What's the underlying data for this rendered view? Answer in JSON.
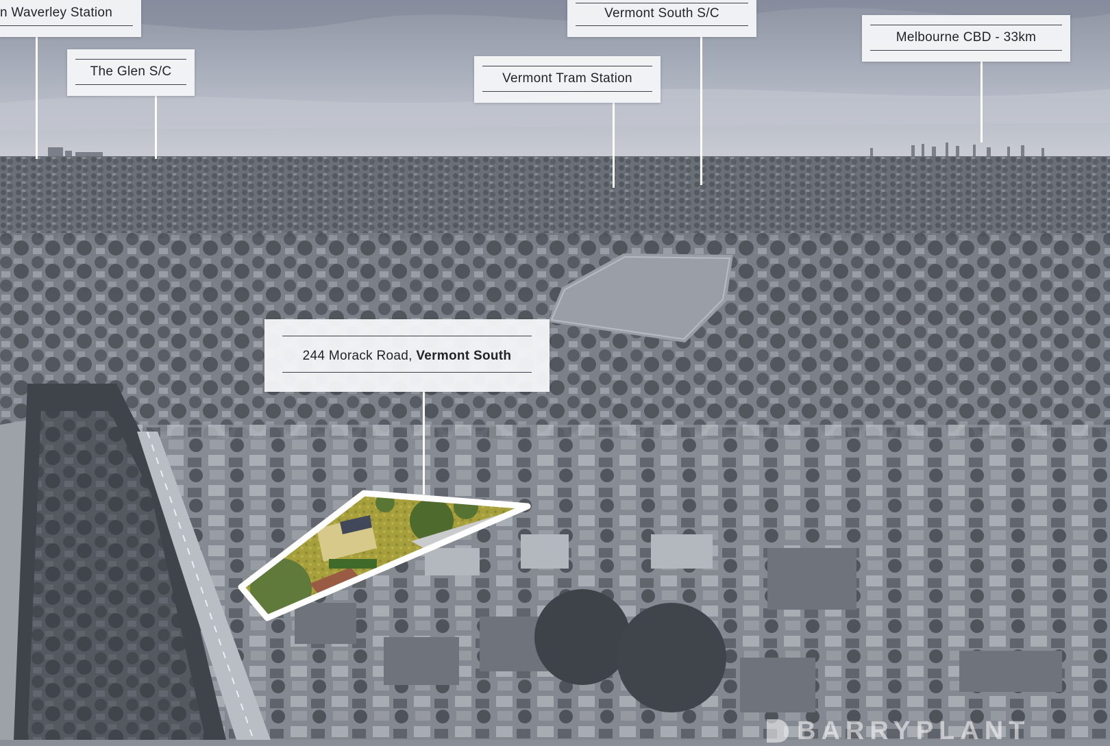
{
  "labels": {
    "waverley": "n Waverley Station",
    "glen": "The Glen S/C",
    "vermont_south_sc": "Vermont South S/C",
    "tram": "Vermont Tram Station",
    "cbd": "Melbourne CBD - 33km",
    "property_street": "244 Morack Road, ",
    "property_suburb": "Vermont South"
  },
  "brand": {
    "watermark": "BARRYPLANT"
  },
  "colors": {
    "sky": "#a7adbb",
    "ground": "#7d8189",
    "callout_bg": "#f4f5f7",
    "pin": "#ffffff",
    "highlight_outline": "#ffffff",
    "highlight_grass": "#a9a23e"
  }
}
